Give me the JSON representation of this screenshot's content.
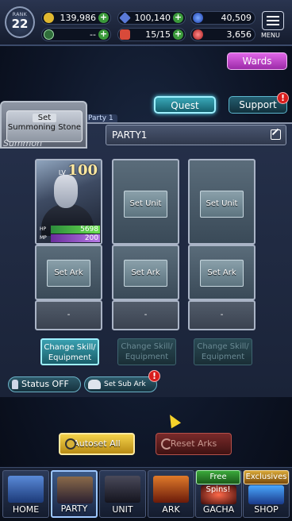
{
  "rank": {
    "label": "RANK",
    "value": "22"
  },
  "resources": {
    "gil": "139,986",
    "gems": "100,140",
    "blue_orbs": "40,509",
    "item2": "--",
    "stamina": "15/15",
    "red_orbs": "3,656"
  },
  "menu_label": "MENU",
  "buttons": {
    "wards": "Wards",
    "quest": "Quest",
    "support": "Support",
    "badge": "!"
  },
  "summon": {
    "set_label": "Set",
    "stone_label": "Summoning Stone",
    "tab_word": "Summon",
    "party_tab": "Party 1"
  },
  "party": {
    "name": "PARTY1",
    "slots": [
      {
        "filled": true,
        "lv_label": "LV",
        "level": "100",
        "hp": "5698",
        "mp": "200",
        "hp_label": "HP",
        "mp_label": "MP",
        "ark": "Set Ark",
        "sub": "-",
        "change": "Change Skill/ Equipment"
      },
      {
        "filled": false,
        "unit": "Set Unit",
        "ark": "Set Ark",
        "sub": "-",
        "change": "Change Skill/ Equipment"
      },
      {
        "filled": false,
        "unit": "Set Unit",
        "ark": "Set Ark",
        "sub": "-",
        "change": "Change Skill/ Equipment"
      }
    ]
  },
  "toggles": {
    "status": "Status OFF",
    "sub_ark": "Set Sub Ark"
  },
  "actions": {
    "autoset": "Autoset All",
    "reset": "Reset Arks"
  },
  "nav": {
    "items": [
      "HOME",
      "PARTY",
      "UNIT",
      "ARK",
      "GACHA",
      "SHOP"
    ],
    "selected": "PARTY",
    "banners": {
      "gacha": "Free Spins!",
      "shop": "Exclusives"
    }
  },
  "colors": {
    "accent_teal": "#3aa0b0",
    "wards_purple": "#c24ccd",
    "autoset_gold": "#f4d24a",
    "reset_red": "#7a2a2a",
    "hp_green": "#6adf4f",
    "mp_purple": "#b77ae6"
  }
}
